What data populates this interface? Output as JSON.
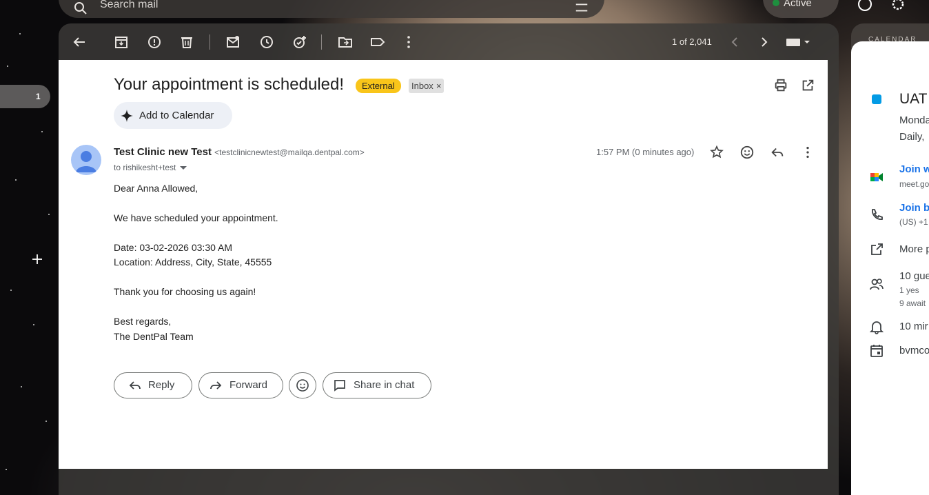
{
  "search": {
    "placeholder": "Search mail"
  },
  "status": {
    "label": "Active"
  },
  "nav": {
    "count": "1"
  },
  "toolbar": {
    "icons": [
      "back-icon",
      "archive-icon",
      "report-spam-icon",
      "delete-icon",
      "mark-unread-icon",
      "snooze-icon",
      "add-task-icon",
      "move-to-icon",
      "label-icon",
      "more-vert-icon"
    ],
    "pager": "1 of 2,041"
  },
  "email": {
    "subject": "Your appointment is scheduled!",
    "badges": {
      "external": "External",
      "inbox": "Inbox",
      "inbox_remove": "×"
    },
    "add_to_calendar": "Add to Calendar",
    "sender_name": "Test Clinic new Test",
    "sender_email": "<testclinicnewtest@mailqa.dentpal.com>",
    "to": "to rishikesht+test",
    "time": "1:57 PM (0 minutes ago)",
    "body": [
      "Dear Anna Allowed,",
      "We have scheduled your appointment.",
      "Date: 03-02-2026 03:30 AM",
      "Location: Address, City, State, 45555",
      "Thank you for choosing us again!",
      "Best regards,",
      "The DentPal Team"
    ],
    "actions": {
      "reply": "Reply",
      "forward": "Forward",
      "share": "Share in chat"
    }
  },
  "calendar_panel": {
    "label": "CALENDAR",
    "title": "UAT",
    "date": "Monda",
    "recurrence": "Daily,",
    "join_video": "Join w",
    "meet_url": "meet.go",
    "join_phone": "Join b",
    "phone": "(US) +1",
    "more": "More p",
    "guests": "10 gue",
    "guests_yes": "1 yes",
    "guests_await": "9 await",
    "reminder": "10 mir",
    "organizer": "bvmco"
  },
  "colors": {
    "external_badge": "#f9c51a",
    "link": "#1a73e8",
    "event": "#039be5"
  }
}
